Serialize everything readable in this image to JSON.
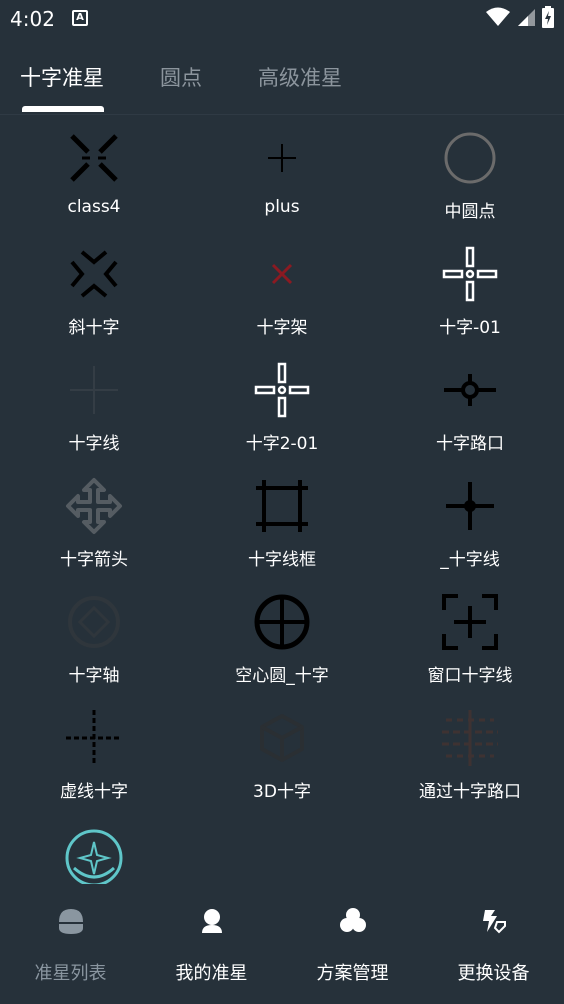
{
  "status_bar": {
    "time": "4:02",
    "notification_icon": "a-badge-icon"
  },
  "tabs": [
    {
      "label": "十字准星",
      "active": true
    },
    {
      "label": "圆点",
      "active": false
    },
    {
      "label": "高级准星",
      "active": false
    }
  ],
  "crosshairs": [
    {
      "label": "class4",
      "icon": "class4-icon"
    },
    {
      "label": "plus",
      "icon": "plus-icon"
    },
    {
      "label": "中圆点",
      "icon": "circle-icon"
    },
    {
      "label": "斜十字",
      "icon": "diagonal-cross-icon"
    },
    {
      "label": "十字架",
      "icon": "x-mark-icon"
    },
    {
      "label": "十字-01",
      "icon": "cross-01-icon"
    },
    {
      "label": "十字线",
      "icon": "faint-crossline-icon"
    },
    {
      "label": "十字2-01",
      "icon": "cross2-01-icon"
    },
    {
      "label": "十字路口",
      "icon": "crossroad-icon"
    },
    {
      "label": "十字箭头",
      "icon": "cross-arrow-icon"
    },
    {
      "label": "十字线框",
      "icon": "crossline-frame-icon"
    },
    {
      "label": "_十字线",
      "icon": "underscore-crossline-icon"
    },
    {
      "label": "十字轴",
      "icon": "cross-axis-icon"
    },
    {
      "label": "空心圆_十字",
      "icon": "hollow-circle-cross-icon"
    },
    {
      "label": "窗口十字线",
      "icon": "window-crossline-icon"
    },
    {
      "label": "虚线十字",
      "icon": "dashed-cross-icon"
    },
    {
      "label": "3D十字",
      "icon": "cube-3d-icon"
    },
    {
      "label": "通过十字路口",
      "icon": "through-crossroad-icon"
    },
    {
      "label": "",
      "icon": "teal-emblem-icon"
    }
  ],
  "bottom_nav": [
    {
      "label": "准星列表",
      "icon": "crosshair-list-icon",
      "active": true
    },
    {
      "label": "我的准星",
      "icon": "person-icon",
      "active": false
    },
    {
      "label": "方案管理",
      "icon": "clover-icon",
      "active": false
    },
    {
      "label": "更换设备",
      "icon": "device-swap-icon",
      "active": false
    }
  ],
  "colors": {
    "background": "#26313a",
    "active_tab": "#ffffff",
    "inactive_tab": "#8c959d",
    "active_nav": "#8a96a0",
    "teal_accent": "#5fc6c9",
    "red_mark": "#8b1a22"
  }
}
